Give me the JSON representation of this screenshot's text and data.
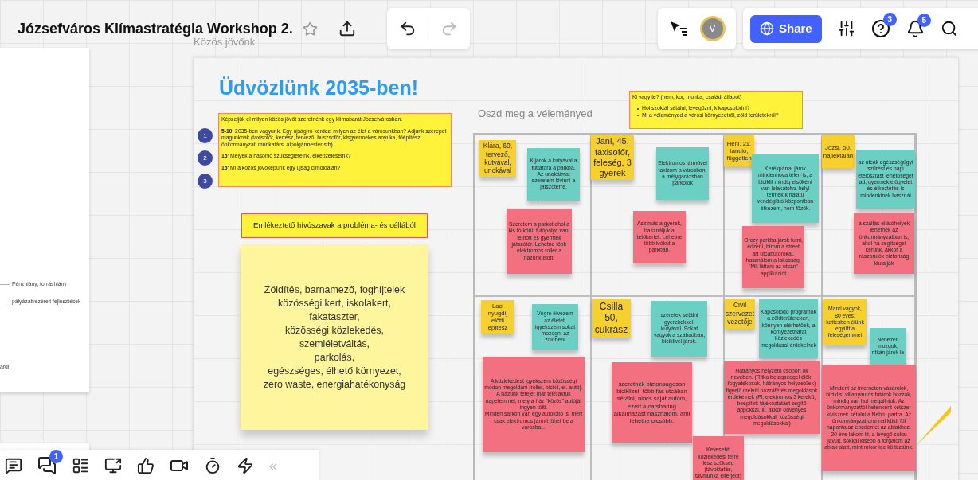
{
  "board": {
    "title": "Józsefváros Klímastratégia Workshop 2.",
    "frame_label": "Közös jövőnk"
  },
  "top_right": {
    "avatar": "V",
    "share_label": "Share",
    "help_badge": "3",
    "notifications_badge": "5"
  },
  "left_frame": {
    "items": [
      {
        "text": "Pénzhiány, forráshiány",
        "kind": "branch"
      },
      {
        "text": "pályázatvezérelt fejlesztések",
        "kind": "branch"
      },
      {
        "text": "árdi",
        "kind": "plain"
      }
    ]
  },
  "welcome": {
    "heading": "Üdvözlünk 2035-ben!",
    "intro": "Képzeljük el milyen közös jövőt szeretnénk egy klímabarát Józsefvárosban.",
    "steps": [
      {
        "number": "1",
        "text": "**5-10'** 2035-ben vagyunk. Egy újságíró kérdezi milyen az élet a városunkban? Adjunk szerepet magunknak (taxisofőr, kertész, tervező, buszsofőr, kisgyermekes anyuka, főépítész, önkormányzati munkatárs, alpolgármester stb)."
      },
      {
        "number": "2",
        "text": "**15'** Melyek a hasonló szükségleteink, elképzeléseink?"
      },
      {
        "number": "3",
        "text": "**15'** Mi a közös jövőképünk egy újság címoldalán?"
      }
    ]
  },
  "reminder": {
    "title": "Emlékeztető hívószavak a probléma- és célfából",
    "note": "Zöldítés, barnamező, foghíjtelek\nközösségi kert, iskolakert,\nfakataszter,\nközösségi közlekedés,\nszemléletváltás,\nparkolás,\negészséges, élhető környezet,\nzero waste, energiahatékonyság"
  },
  "opinion": {
    "title": "Oszd meg a véleményed",
    "question": "Ki vagy te? (nem, kor, munka, családi állapot)",
    "bullets": [
      "Hol szoktál sétálni, levegőzni, kikapcsolódni?",
      "Mi a véleményed a városi környezetről, zöld területekről?"
    ]
  },
  "notes": [
    {
      "text": "Klára, 60, tervező, kutyával, unokával",
      "color": "#f5d02e"
    },
    {
      "text": "Kijárok a kutyával a futtatóra a parkba. Az unokáimat szeretem kivinni a játszótérre.",
      "color": "#6ccfc4"
    },
    {
      "text": "Szeretem a parkot ahol a kis tó körül futópálya van, felnőtt és gyermek játszótér. Lehetne több elektromos roller a házunk előtt.",
      "color": "#f2707f"
    },
    {
      "text": "Jani, 45, taxisofőr, feleség, 3 gyerek",
      "color": "#f5d02e"
    },
    {
      "text": "Elektromos járművel taxizom a városban, a mélygarázsban parkolok",
      "color": "#6ccfc4"
    },
    {
      "text": "Asztmás a gyerek, használjuk a tetőkertet. Lehetne több ivókút a parkban.",
      "color": "#f2707f"
    },
    {
      "text": "Heni, 21, tanuló, független",
      "color": "#f5d02e"
    },
    {
      "text": "Kerékpárral járok mindenhova télen is, a biciklit mindig elsőként van lelakatolva helyi termék kínálatú vendéglátó központban étkezem, nem főzök.",
      "color": "#6ccfc4"
    },
    {
      "text": "Orczy parkba járok futni, edzeni, bírom a street art utcabútorokat, használom a lakossági \"Mit láttam az utcán\" applikációt",
      "color": "#f2707f"
    },
    {
      "text": "Józsi, 50, hajléktalan",
      "color": "#f5d02e"
    },
    {
      "text": "az utcák egészségügyi szűrést és napi ételosztást lehetőséget ad, gyermekfelügyelet és étkeztetés is mindenkinek használ",
      "color": "#6ccfc4"
    },
    {
      "text": "a szállás ellátóhelyek lehetnek az önkormányzatban is, ahol ha segítséget kérünk, akkor a rászorulók biztonság kiutalják",
      "color": "#f2707f"
    },
    {
      "text": "Laci nyugdíj előtti építész",
      "color": "#f5d02e"
    },
    {
      "text": "Végre élvezem az életet, igyekszem sokat mozogni az zöldben!",
      "color": "#6ccfc4"
    },
    {
      "text": "A közlekedést igyekszem közösségi módon megoldani (roller, bicikli, el. autó).\nA házunk tetejét már teleraktuk napelemmel, mely a ház \"közös\" autóját ingyen tölti.\nMinden sarkon van egy autótöltő is, mert csak elektromos jármű jöhet be a városba...",
      "color": "#f2707f"
    },
    {
      "text": "Csilla 50, cukrász",
      "color": "#f5d02e"
    },
    {
      "text": "szeretek sétálni gyerekekkel, kutyával. Sokat vagyok a szabadban, biciklivel járok.",
      "color": "#6ccfc4"
    },
    {
      "text": "szeretnék biztonságosan biciklizni, több fás utcában sétálni, nincs saját autóm, ezért a carsharing alkalmazást használom, ami lehetne olcsóbb.",
      "color": "#f2707f"
    },
    {
      "text": "Civil szervezet vezetője",
      "color": "#f5d02e"
    },
    {
      "text": "Kapcsolódó programok a zöldterületeken, könnyen elérhetőek, a környezetbarát közlekedés megoldásai érdekelnek",
      "color": "#6ccfc4"
    },
    {
      "text": "Hátrányos helyzetű csoport ok nevében. (Ritka betegséggel élők, fogyatékosok, hátrányos helyzetűek) figyelő mélyíti hozzáférés megoldások érdekelnek (Pl. elektromos 3 kerekű, beépített tájékoztatást segítő appokkal, ill. akkor önvényes megoldásokkal, közösségi megoldásokkal)",
      "color": "#f2707f"
    },
    {
      "text": "Kevesebb közlekedési térre lesz szükség (távoktatás, távmunka elterjedt)",
      "color": "#f2707f"
    },
    {
      "text": "Marci vagyok, 80 éves, kettesben élünk együtt a feleségemmel",
      "color": "#f5d02e"
    },
    {
      "text": "Nehezen mozgok, ritkán járok le",
      "color": "#6ccfc4"
    },
    {
      "text": "Mindent az interneten vásárolok, biciklis, villanyautós futárok hozzák, mindig van hol megállniuk. Az önkormányzattól hetenként kétszer kivisznek sétálni a Nehru partra. Az önkormányzat drónnal küldi föl naponta az ebédemet az ablakhoz.\n20 éve lakom itt, a levegő sokat javult, sokkal kisebb a forgalom az ablak alatt, mint mikor ide költöztünk.",
      "color": "#f2707f"
    }
  ],
  "bottom_toolbar": {
    "chat_badge": "1",
    "collapse": "«"
  }
}
